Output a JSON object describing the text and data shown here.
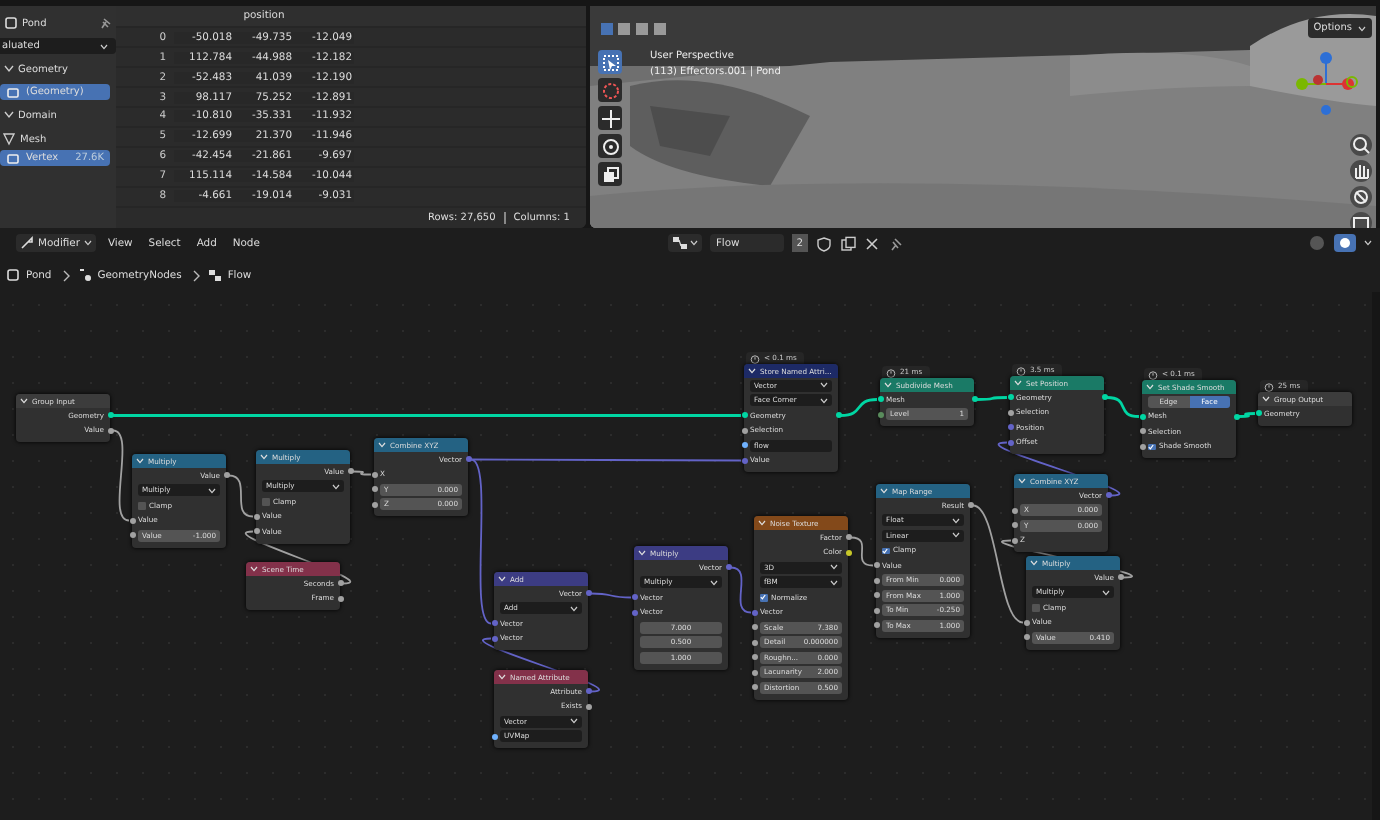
{
  "spreadsheet": {
    "object": "Pond",
    "evaluation": "aluated",
    "tree": [
      {
        "kind": "header",
        "label": "Geometry"
      },
      {
        "kind": "item",
        "label": "(Geometry)",
        "selected": true
      },
      {
        "kind": "header",
        "label": "Domain"
      },
      {
        "kind": "group",
        "label": "Mesh"
      },
      {
        "kind": "item",
        "label": "Vertex",
        "count": "27.6K",
        "selected": true
      }
    ],
    "column": "position",
    "rows": [
      {
        "index": "0",
        "values": [
          "-50.018",
          "-49.735",
          "-12.049"
        ]
      },
      {
        "index": "1",
        "values": [
          "112.784",
          "-44.988",
          "-12.182"
        ]
      },
      {
        "index": "2",
        "values": [
          "-52.483",
          "41.039",
          "-12.190"
        ]
      },
      {
        "index": "3",
        "values": [
          "98.117",
          "75.252",
          "-12.891"
        ]
      },
      {
        "index": "4",
        "values": [
          "-10.810",
          "-35.331",
          "-11.932"
        ]
      },
      {
        "index": "5",
        "values": [
          "-12.699",
          "21.370",
          "-11.946"
        ]
      },
      {
        "index": "6",
        "values": [
          "-42.454",
          "-21.861",
          "-9.697"
        ]
      },
      {
        "index": "7",
        "values": [
          "115.114",
          "-14.584",
          "-10.044"
        ]
      },
      {
        "index": "8",
        "values": [
          "-4.661",
          "-19.014",
          "-9.031"
        ]
      }
    ],
    "rows_count": "Rows: 27,650",
    "columns_count": "Columns: 1"
  },
  "viewport": {
    "view_name": "User Perspective",
    "object_info": "(113) Effectors.001 | Pond",
    "options_button": "Options"
  },
  "node_editor": {
    "context": "Modifier",
    "menus": [
      "View",
      "Select",
      "Add",
      "Node"
    ],
    "tree_name": "Flow",
    "users": "2",
    "breadcrumb": [
      "Pond",
      "GeometryNodes",
      "Flow"
    ],
    "nodes": [
      {
        "title": "Group Input",
        "color": "#3c3c3c",
        "rows": [
          {
            "kind": "output",
            "label": "Geometry",
            "color": "#00d6a3"
          },
          {
            "kind": "output",
            "label": "Value",
            "color": "#a1a1a1"
          }
        ]
      },
      {
        "title": "Store Named Attri...",
        "color": "#1d2a66",
        "timing": "< 0.1 ms",
        "rows": [
          {
            "kind": "dropdown",
            "label": "Vector"
          },
          {
            "kind": "dropdown",
            "label": "Face Corner"
          },
          {
            "kind": "through",
            "label": "Geometry",
            "color": "#00d6a3"
          },
          {
            "kind": "input",
            "label": "Selection",
            "color": "#a1a1a1"
          },
          {
            "kind": "text",
            "value": "flow",
            "color": "#70b2ff"
          },
          {
            "kind": "input",
            "label": "Value",
            "color": "#6363c7"
          }
        ]
      },
      {
        "title": "Subdivide Mesh",
        "color": "#1a7a66",
        "timing": "21 ms",
        "rows": [
          {
            "kind": "through",
            "label": "Mesh",
            "color": "#00d6a3"
          },
          {
            "kind": "field",
            "label": "Level",
            "value": "1",
            "color": "#598c5c"
          }
        ]
      },
      {
        "title": "Set Position",
        "color": "#1a7a66",
        "timing": "3.5 ms",
        "rows": [
          {
            "kind": "through",
            "label": "Geometry",
            "color": "#00d6a3"
          },
          {
            "kind": "input",
            "label": "Selection",
            "color": "#a1a1a1"
          },
          {
            "kind": "input",
            "label": "Position",
            "color": "#6363c7"
          },
          {
            "kind": "input",
            "label": "Offset",
            "color": "#6363c7"
          }
        ]
      },
      {
        "title": "Set Shade Smooth",
        "color": "#1a7a66",
        "timing": "< 0.1 ms",
        "rows": [
          {
            "kind": "toggle",
            "options": [
              {
                "label": "Edge",
                "selected": false
              },
              {
                "label": "Face",
                "selected": true
              }
            ]
          },
          {
            "kind": "through",
            "label": "Mesh",
            "color": "#00d6a3"
          },
          {
            "kind": "input",
            "label": "Selection",
            "color": "#a1a1a1"
          },
          {
            "kind": "checkbox",
            "label": "Shade Smooth",
            "checked": true,
            "color": "#a1a1a1"
          }
        ]
      },
      {
        "title": "Group Output",
        "color": "#3c3c3c",
        "timing": "25 ms",
        "rows": [
          {
            "kind": "input",
            "label": "Geometry",
            "color": "#00d6a3"
          }
        ]
      },
      {
        "title": "Multiply",
        "color": "#246283",
        "rows": [
          {
            "kind": "output",
            "label": "Value",
            "color": "#a1a1a1"
          },
          {
            "kind": "dropdown",
            "label": "Multiply"
          },
          {
            "kind": "checkbox",
            "label": "Clamp",
            "checked": false
          },
          {
            "kind": "input",
            "label": "Value",
            "color": "#a1a1a1"
          },
          {
            "kind": "field",
            "label": "Value",
            "value": "-1.000",
            "color": "#a1a1a1"
          }
        ]
      },
      {
        "title": "Multiply",
        "color": "#246283",
        "rows": [
          {
            "kind": "output",
            "label": "Value",
            "color": "#a1a1a1"
          },
          {
            "kind": "dropdown",
            "label": "Multiply"
          },
          {
            "kind": "checkbox",
            "label": "Clamp",
            "checked": false
          },
          {
            "kind": "input",
            "label": "Value",
            "color": "#a1a1a1"
          },
          {
            "kind": "input",
            "label": "Value",
            "color": "#a1a1a1"
          }
        ]
      },
      {
        "title": "Scene Time",
        "color": "#83314a",
        "rows": [
          {
            "kind": "output",
            "label": "Seconds",
            "color": "#a1a1a1"
          },
          {
            "kind": "output",
            "label": "Frame",
            "color": "#a1a1a1"
          }
        ]
      },
      {
        "title": "Combine XYZ",
        "color": "#246283",
        "rows": [
          {
            "kind": "output",
            "label": "Vector",
            "color": "#6363c7"
          },
          {
            "kind": "input",
            "label": "X",
            "color": "#a1a1a1"
          },
          {
            "kind": "field",
            "label": "Y",
            "value": "0.000",
            "color": "#a1a1a1"
          },
          {
            "kind": "field",
            "label": "Z",
            "value": "0.000",
            "color": "#a1a1a1"
          }
        ]
      },
      {
        "title": "Add",
        "color": "#3c3c83",
        "rows": [
          {
            "kind": "output",
            "label": "Vector",
            "color": "#6363c7"
          },
          {
            "kind": "dropdown",
            "label": "Add"
          },
          {
            "kind": "input",
            "label": "Vector",
            "color": "#6363c7"
          },
          {
            "kind": "input",
            "label": "Vector",
            "color": "#6363c7"
          }
        ]
      },
      {
        "title": "Named Attribute",
        "color": "#83314a",
        "rows": [
          {
            "kind": "output",
            "label": "Attribute",
            "color": "#6363c7"
          },
          {
            "kind": "output",
            "label": "Exists",
            "color": "#a1a1a1"
          },
          {
            "kind": "dropdown",
            "label": "Vector"
          },
          {
            "kind": "text",
            "value": "UVMap",
            "color": "#70b2ff"
          }
        ]
      },
      {
        "title": "Multiply",
        "color": "#3c3c83",
        "rows": [
          {
            "kind": "output",
            "label": "Vector",
            "color": "#6363c7"
          },
          {
            "kind": "dropdown",
            "label": "Multiply"
          },
          {
            "kind": "input",
            "label": "Vector",
            "color": "#6363c7"
          },
          {
            "kind": "input",
            "label": "Vector",
            "color": "#6363c7"
          },
          {
            "kind": "number",
            "value": "7.000"
          },
          {
            "kind": "number",
            "value": "0.500"
          },
          {
            "kind": "number",
            "value": "1.000"
          }
        ]
      },
      {
        "title": "Noise Texture",
        "color": "#83491a",
        "rows": [
          {
            "kind": "output",
            "label": "Factor",
            "color": "#a1a1a1"
          },
          {
            "kind": "output",
            "label": "Color",
            "color": "#c7c729"
          },
          {
            "kind": "dropdown",
            "label": "3D"
          },
          {
            "kind": "dropdown",
            "label": "fBM"
          },
          {
            "kind": "checkbox",
            "label": "Normalize",
            "checked": true
          },
          {
            "kind": "input",
            "label": "Vector",
            "color": "#6363c7"
          },
          {
            "kind": "field",
            "label": "Scale",
            "value": "7.380",
            "color": "#a1a1a1"
          },
          {
            "kind": "field",
            "label": "Detail",
            "value": "0.000000",
            "color": "#a1a1a1"
          },
          {
            "kind": "field",
            "label": "Roughn...",
            "value": "0.000",
            "color": "#a1a1a1"
          },
          {
            "kind": "field",
            "label": "Lacunarity",
            "value": "2.000",
            "color": "#a1a1a1"
          },
          {
            "kind": "field",
            "label": "Distortion",
            "value": "0.500",
            "color": "#a1a1a1"
          }
        ]
      },
      {
        "title": "Map Range",
        "color": "#246283",
        "rows": [
          {
            "kind": "output",
            "label": "Result",
            "color": "#a1a1a1"
          },
          {
            "kind": "dropdown",
            "label": "Float"
          },
          {
            "kind": "dropdown",
            "label": "Linear"
          },
          {
            "kind": "checkbox",
            "label": "Clamp",
            "checked": true
          },
          {
            "kind": "input",
            "label": "Value",
            "color": "#a1a1a1"
          },
          {
            "kind": "field",
            "label": "From Min",
            "value": "0.000",
            "color": "#a1a1a1"
          },
          {
            "kind": "field",
            "label": "From Max",
            "value": "1.000",
            "color": "#a1a1a1"
          },
          {
            "kind": "field",
            "label": "To Min",
            "value": "-0.250",
            "color": "#a1a1a1"
          },
          {
            "kind": "field",
            "label": "To Max",
            "value": "1.000",
            "color": "#a1a1a1"
          }
        ]
      },
      {
        "title": "Combine XYZ",
        "color": "#246283",
        "rows": [
          {
            "kind": "output",
            "label": "Vector",
            "color": "#6363c7"
          },
          {
            "kind": "field",
            "label": "X",
            "value": "0.000",
            "color": "#a1a1a1"
          },
          {
            "kind": "field",
            "label": "Y",
            "value": "0.000",
            "color": "#a1a1a1"
          },
          {
            "kind": "input",
            "label": "Z",
            "color": "#a1a1a1"
          }
        ]
      },
      {
        "title": "Multiply",
        "color": "#246283",
        "rows": [
          {
            "kind": "output",
            "label": "Value",
            "color": "#a1a1a1"
          },
          {
            "kind": "dropdown",
            "label": "Multiply"
          },
          {
            "kind": "checkbox",
            "label": "Clamp",
            "checked": false
          },
          {
            "kind": "input",
            "label": "Value",
            "color": "#a1a1a1"
          },
          {
            "kind": "field",
            "label": "Value",
            "value": "0.410",
            "color": "#a1a1a1"
          }
        ]
      }
    ]
  }
}
